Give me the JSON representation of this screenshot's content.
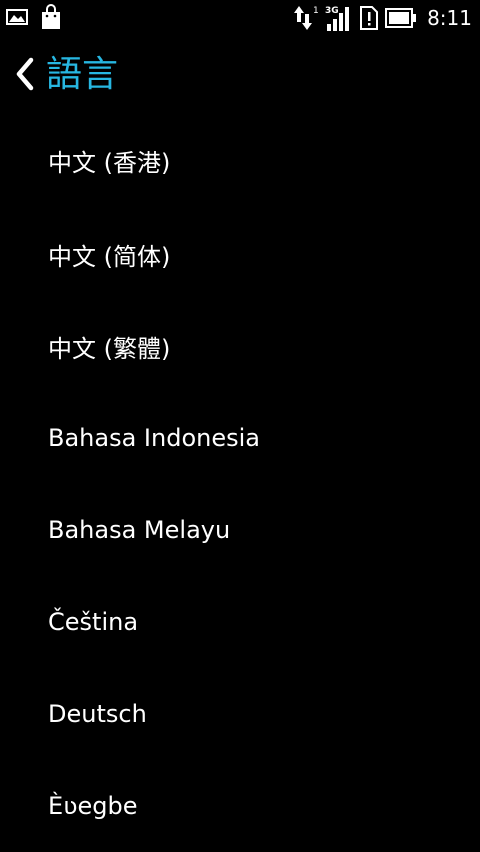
{
  "status_bar": {
    "time": "8:11",
    "network_type": "3G",
    "data_indicator": "1",
    "icons": [
      "image-icon",
      "shopping-bag-icon",
      "data-transfer-icon",
      "signal-icon",
      "alert-icon",
      "battery-icon"
    ]
  },
  "header": {
    "title": "語言",
    "back_icon": "chevron-left-icon"
  },
  "languages": [
    {
      "label": "中文 (香港)"
    },
    {
      "label": "中文 (简体)"
    },
    {
      "label": "中文 (繁體)"
    },
    {
      "label": "Bahasa Indonesia"
    },
    {
      "label": "Bahasa Melayu"
    },
    {
      "label": "Čeština"
    },
    {
      "label": "Deutsch"
    },
    {
      "label": "Èʋegbe"
    }
  ],
  "colors": {
    "background": "#000000",
    "accent": "#27b7e2",
    "text": "#ffffff"
  }
}
